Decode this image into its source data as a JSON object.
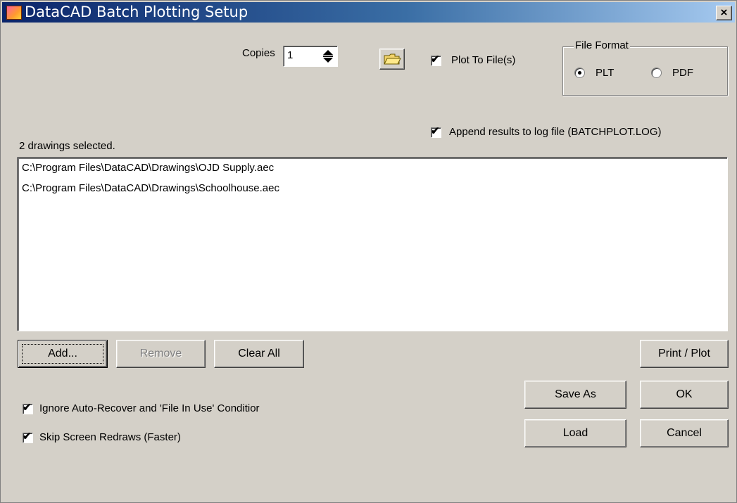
{
  "window": {
    "title": "DataCAD Batch Plotting Setup",
    "close_label": "×"
  },
  "copies": {
    "label": "Copies",
    "value": "1"
  },
  "plot_to_file": {
    "label": "Plot To File(s)",
    "checked": true
  },
  "file_format": {
    "legend": "File Format",
    "options": [
      {
        "label": "PLT",
        "selected": true
      },
      {
        "label": "PDF",
        "selected": false
      }
    ]
  },
  "append_log": {
    "label": "Append results to log file (BATCHPLOT.LOG)",
    "checked": true
  },
  "selection_status": "2 drawings selected.",
  "drawings": [
    "C:\\Program Files\\DataCAD\\Drawings\\OJD Supply.aec",
    "C:\\Program Files\\DataCAD\\Drawings\\Schoolhouse.aec"
  ],
  "buttons": {
    "add": "Add...",
    "remove": "Remove",
    "clear_all": "Clear All",
    "print_plot": "Print / Plot",
    "save_as": "Save As",
    "ok": "OK",
    "load": "Load",
    "cancel": "Cancel"
  },
  "options": {
    "ignore_autorecover": {
      "label": "Ignore Auto-Recover and 'File In Use' Conditior",
      "checked": true
    },
    "skip_redraws": {
      "label": "Skip Screen Redraws (Faster)",
      "checked": true
    }
  },
  "check_mark": "✔",
  "colors": {
    "titlebar_start": "#0a246a",
    "titlebar_end": "#a6caf0",
    "face": "#d4d0c8"
  }
}
